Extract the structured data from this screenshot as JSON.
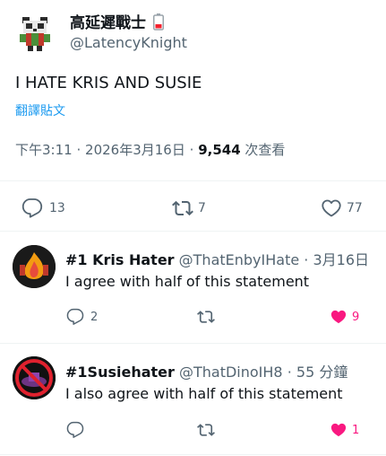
{
  "post": {
    "display_name": "高延遲戰士",
    "handle": "@LatencyKnight",
    "text": "I HATE KRIS AND SUSIE",
    "translate_label": "翻譯貼文",
    "time": "下午3:11",
    "sep1": "·",
    "date": "2026年3月16日",
    "sep2": "·",
    "views": "9,544",
    "views_label": "次查看",
    "stats": {
      "replies": "13",
      "reposts": "7",
      "likes": "77"
    }
  },
  "replies": [
    {
      "name": "#1 Kris Hater",
      "handle": "@ThatEnbyIHate",
      "dot": "·",
      "time": "3月16日",
      "text": "I agree with half of this statement",
      "reply_count": "2",
      "repost_count": "",
      "like_count": "9",
      "liked": true
    },
    {
      "name": "#1Susiehater",
      "handle": "@ThatDinoIH8",
      "dot": "·",
      "time": "55 分鐘",
      "text": "I also agree with half of this statement",
      "reply_count": "",
      "repost_count": "",
      "like_count": "1",
      "liked": true
    }
  ],
  "colors": {
    "accent": "#1d9bf0",
    "like": "#f91880",
    "muted": "#536471",
    "text": "#0f1419",
    "divider": "#eff3f4"
  },
  "icons": {
    "reply": "reply-bubble-icon",
    "repost": "repost-arrows-icon",
    "like": "heart-icon",
    "badge": "battery-low-icon"
  }
}
